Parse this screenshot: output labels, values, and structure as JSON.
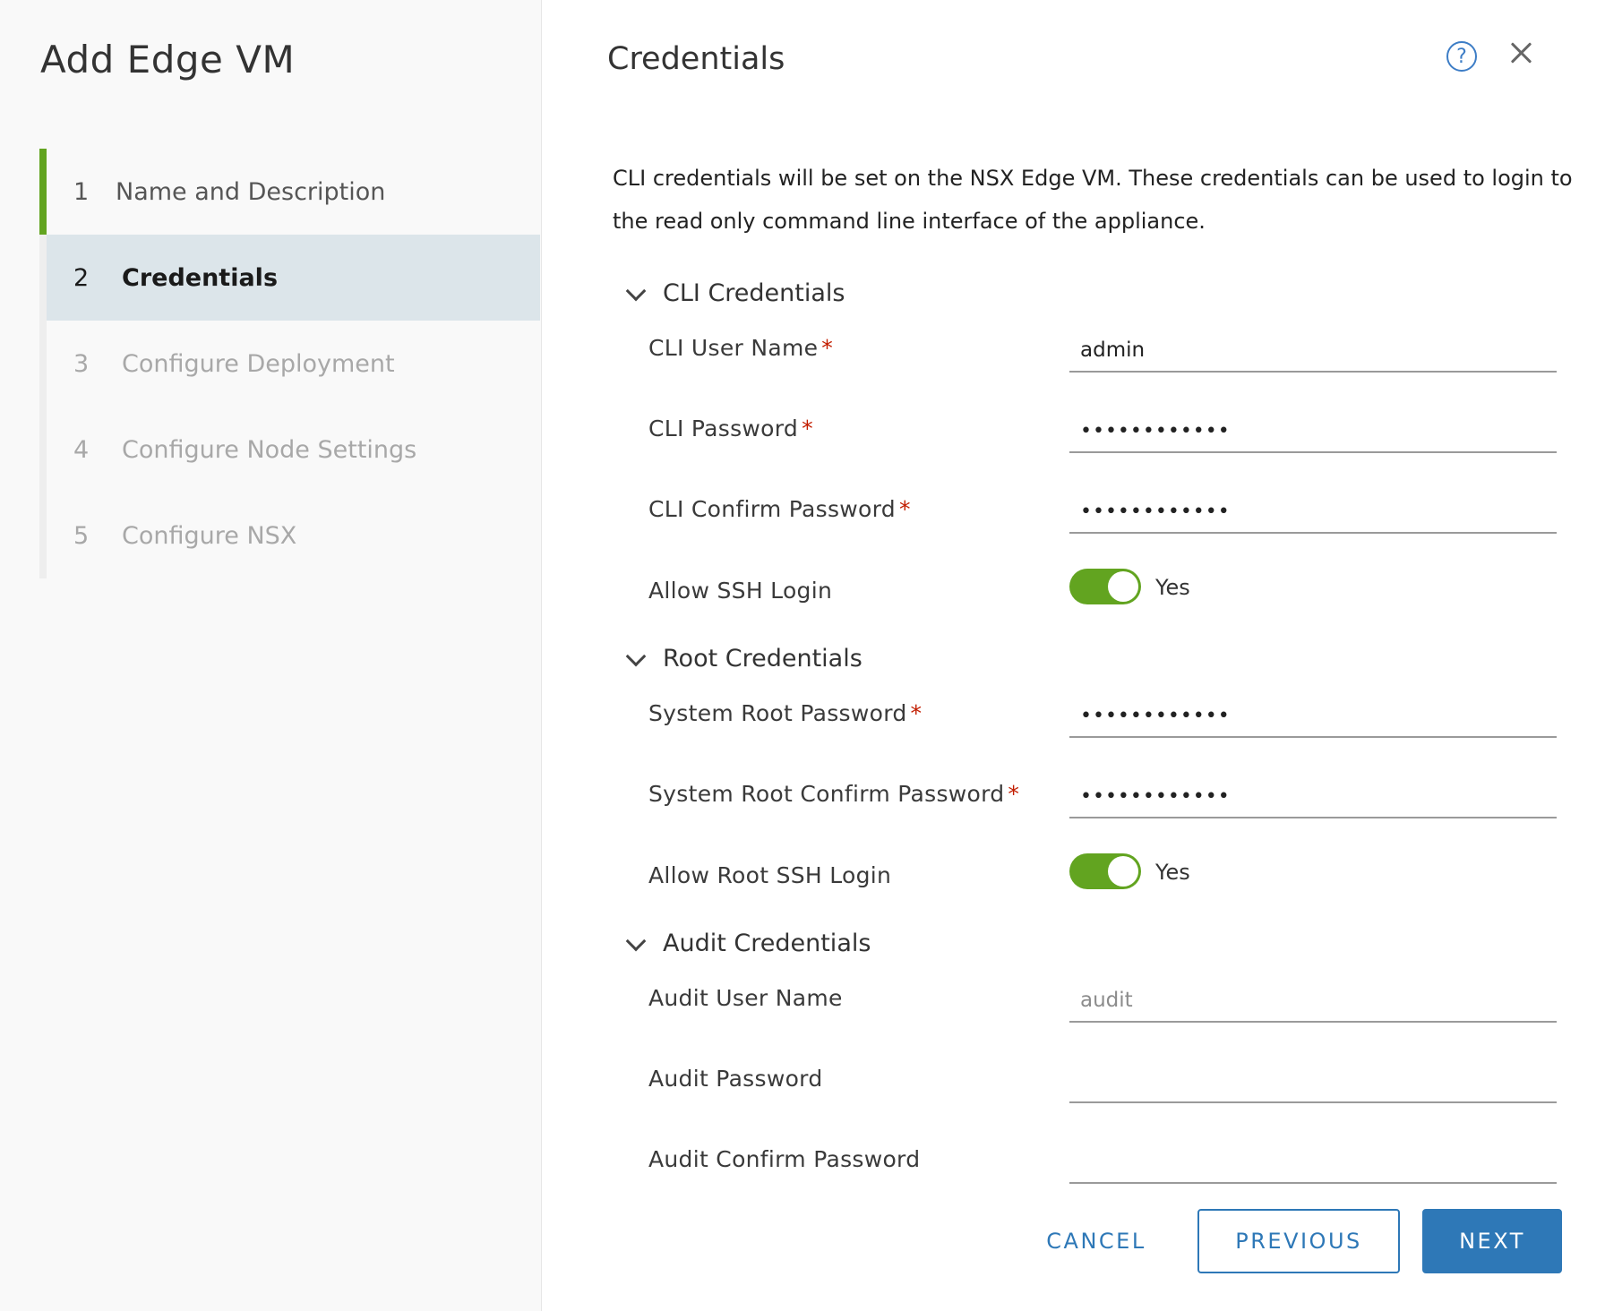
{
  "wizard": {
    "title": "Add Edge VM",
    "steps": [
      {
        "num": "1",
        "label": "Name and Description"
      },
      {
        "num": "2",
        "label": "Credentials"
      },
      {
        "num": "3",
        "label": "Configure Deployment"
      },
      {
        "num": "4",
        "label": "Configure Node Settings"
      },
      {
        "num": "5",
        "label": "Configure NSX"
      }
    ]
  },
  "page": {
    "title": "Credentials",
    "description": "CLI credentials will be set on the NSX Edge VM. These credentials can be used to login to the read only command line interface of the appliance."
  },
  "cli": {
    "section_label": "CLI Credentials",
    "user_name_label": "CLI User Name",
    "user_name_value": "admin",
    "password_label": "CLI Password",
    "password_value": "••••••••••••",
    "confirm_label": "CLI Confirm Password",
    "confirm_value": "••••••••••••",
    "ssh_label": "Allow SSH Login",
    "ssh_value": "Yes"
  },
  "root": {
    "section_label": "Root Credentials",
    "password_label": "System Root Password",
    "password_value": "••••••••••••",
    "confirm_label": "System Root Confirm Password",
    "confirm_value": "••••••••••••",
    "ssh_label": "Allow Root SSH Login",
    "ssh_value": "Yes"
  },
  "audit": {
    "section_label": "Audit Credentials",
    "user_name_label": "Audit User Name",
    "user_name_placeholder": "audit",
    "password_label": "Audit Password",
    "confirm_label": "Audit Confirm Password"
  },
  "footer": {
    "cancel": "CANCEL",
    "previous": "PREVIOUS",
    "next": "NEXT"
  },
  "colors": {
    "accent": "#2e78b7",
    "success": "#62a420",
    "required": "#c21d00",
    "active_step_bg": "#dce5ea"
  },
  "required_mark": "*",
  "icons": {
    "help": "?",
    "close": "close-x"
  }
}
